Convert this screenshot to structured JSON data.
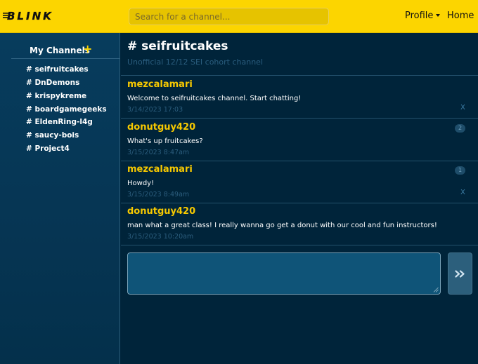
{
  "app": {
    "logo": "BLINK"
  },
  "search": {
    "placeholder": "Search for a channel..."
  },
  "nav": {
    "profile": "Profile",
    "home": "Home"
  },
  "sidebar": {
    "title": "My Channels",
    "add_icon": "+",
    "channels": [
      "# seifruitcakes",
      "# DnDemons",
      "# krispykreme",
      "# boardgamegeeks",
      "# EldenRing-l4g",
      "# saucy-bois",
      "# Project4"
    ]
  },
  "channel": {
    "title": "# seifruitcakes",
    "description": "Unofficial 12/12 SEI cohort channel"
  },
  "messages": [
    {
      "user": "mezcalamari",
      "text": "Welcome to seifruitcakes channel. Start chatting!",
      "time": "3/14/2023 17:03",
      "badge": "",
      "delete": "X"
    },
    {
      "user": "donutguy420",
      "text": "What's up fruitcakes?",
      "time": "3/15/2023 8:47am",
      "badge": "2",
      "delete": ""
    },
    {
      "user": "mezcalamari",
      "text": "Howdy!",
      "time": "3/15/2023 8:49am",
      "badge": "1",
      "delete": "X"
    },
    {
      "user": "donutguy420",
      "text": "man what a great class! I really wanna go get a donut with our cool and fun instructors!",
      "time": "3/15/2023 10:20am",
      "badge": "",
      "delete": ""
    }
  ],
  "composer": {
    "value": "",
    "send_icon": "double-chevron-right-icon"
  },
  "colors": {
    "navbar": "#fcd500",
    "background": "#00243a",
    "sidebar": "#073c5d",
    "username": "#f7c900",
    "timestamp": "#2b5d7d",
    "accent": "#fcd500"
  }
}
